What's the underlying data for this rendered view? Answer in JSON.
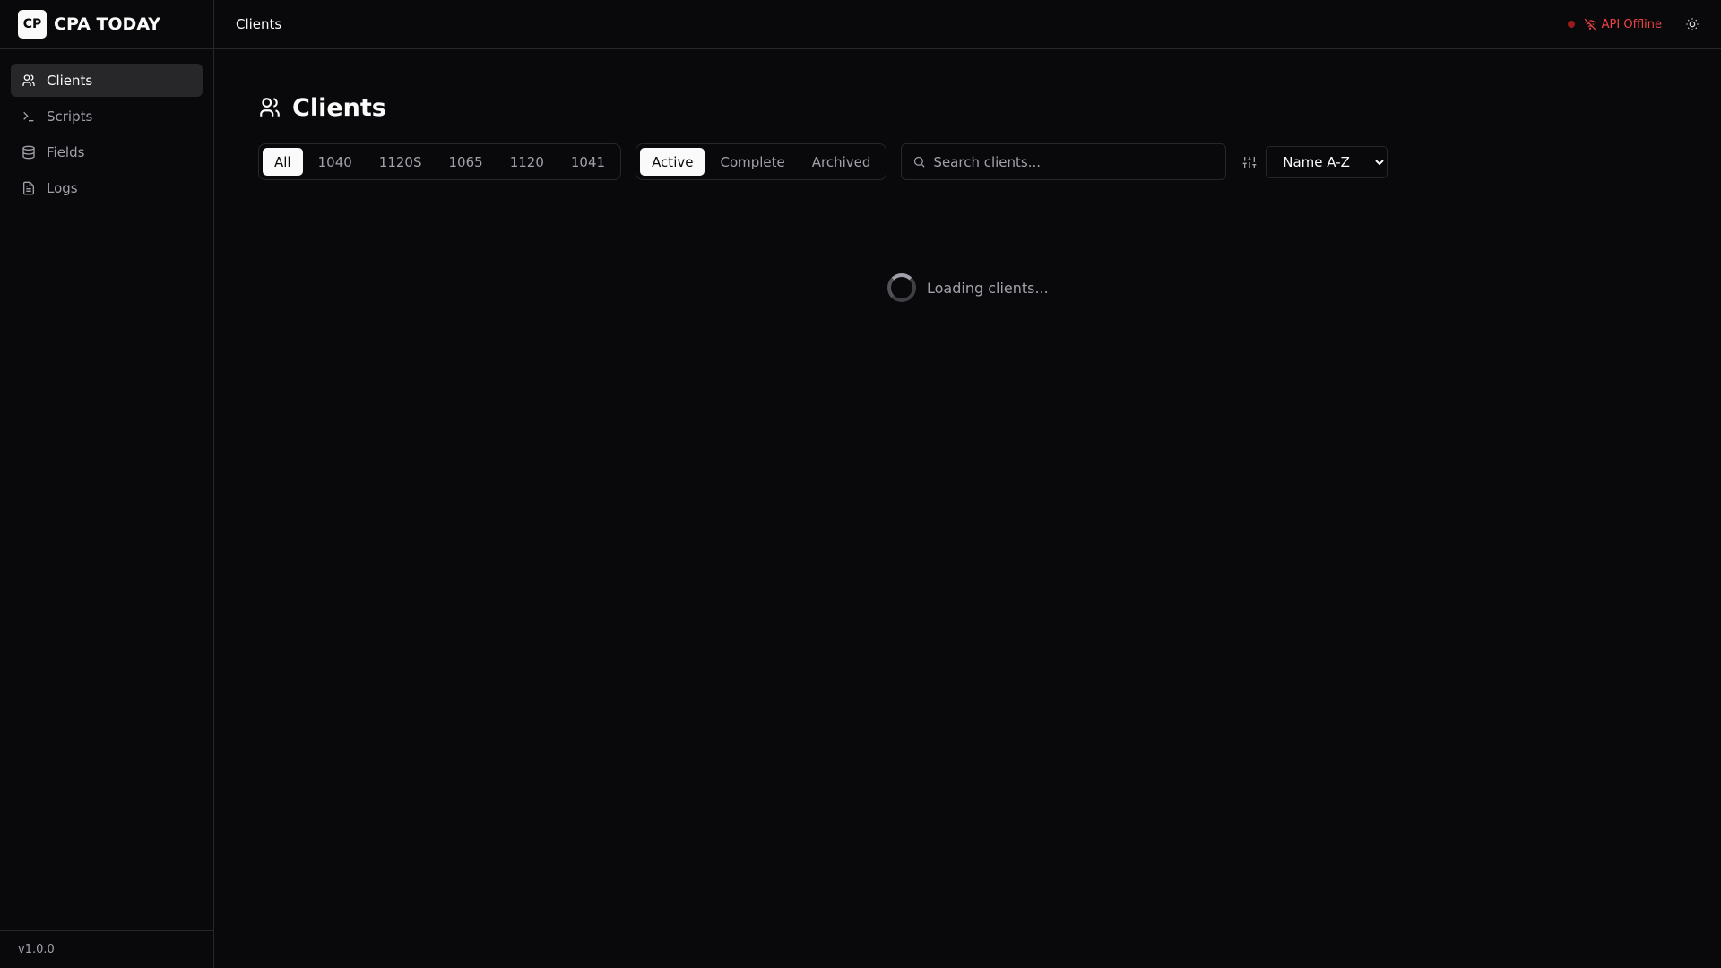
{
  "app": {
    "logo": "CP",
    "name": "CPA TODAY",
    "version": "v1.0.0"
  },
  "sidebar": {
    "items": [
      {
        "label": "Clients",
        "icon": "users-icon"
      },
      {
        "label": "Scripts",
        "icon": "terminal-icon"
      },
      {
        "label": "Fields",
        "icon": "database-icon"
      },
      {
        "label": "Logs",
        "icon": "file-text-icon"
      }
    ]
  },
  "topbar": {
    "breadcrumb": "Clients",
    "api_status": "API Offline",
    "status_color": "#ef4444"
  },
  "main": {
    "title": "Clients",
    "form_filters": [
      "All",
      "1040",
      "1120S",
      "1065",
      "1120",
      "1041"
    ],
    "status_filters": [
      "Active",
      "Complete",
      "Archived"
    ],
    "search_placeholder": "Search clients...",
    "sort": "Name A-Z",
    "loading": "Loading clients..."
  }
}
